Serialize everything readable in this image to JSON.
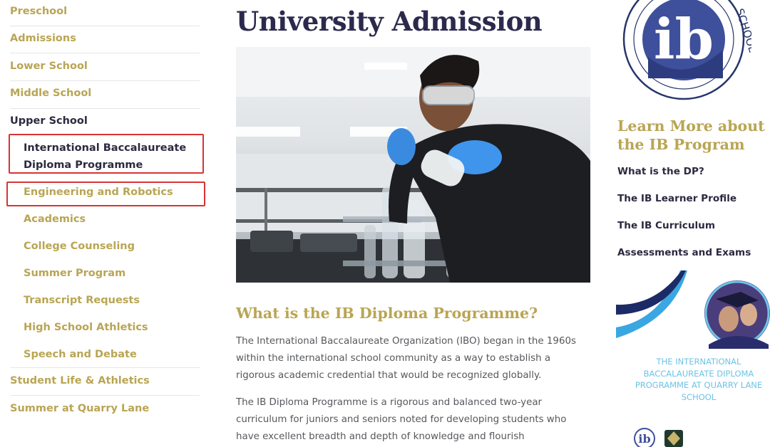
{
  "sidebar": {
    "items": [
      {
        "label": "Preschool"
      },
      {
        "label": "Admissions"
      },
      {
        "label": "Lower School"
      },
      {
        "label": "Middle School"
      },
      {
        "label": "Upper School"
      },
      {
        "label": "Student Life & Athletics"
      },
      {
        "label": "Summer at Quarry Lane"
      }
    ],
    "subitems": [
      {
        "label": "International Baccalaureate Diploma Programme"
      },
      {
        "label": "Engineering and Robotics"
      },
      {
        "label": "Academics"
      },
      {
        "label": "College Counseling"
      },
      {
        "label": "Summer Program"
      },
      {
        "label": "Transcript Requests"
      },
      {
        "label": "High School Athletics"
      },
      {
        "label": "Speech and Debate"
      }
    ]
  },
  "main": {
    "title": "University Admission",
    "section_title": "What is the IB Diploma Programme?",
    "paragraphs": [
      "The International Baccalaureate Organization (IBO) began in the 1960s within the international school community as a way to establish a rigorous academic credential that would be recognized globally.",
      "The IB Diploma Programme is a rigorous and balanced two-year curriculum for juniors and seniors noted for developing students who have excellent breadth and depth of knowledge and flourish intellectually, emotionally, physically and"
    ]
  },
  "right": {
    "logo": {
      "mark": "ib",
      "ring_text": "SCHOOL"
    },
    "learn_title": "Learn More about the IB Program",
    "links": [
      {
        "label": "What is the DP?"
      },
      {
        "label": "The IB Learner Profile"
      },
      {
        "label": "The IB Curriculum"
      },
      {
        "label": "Assessments and Exams"
      }
    ],
    "promo_text": "THE INTERNATIONAL BACCALAUREATE DIPLOMA PROGRAMME AT QUARRY LANE SCHOOL",
    "promo_mini_logo": "ib"
  },
  "colors": {
    "gold": "#b9a553",
    "navy": "#2b2a4d",
    "highlight_red": "#d73434",
    "light_blue": "#6ec3e6"
  }
}
